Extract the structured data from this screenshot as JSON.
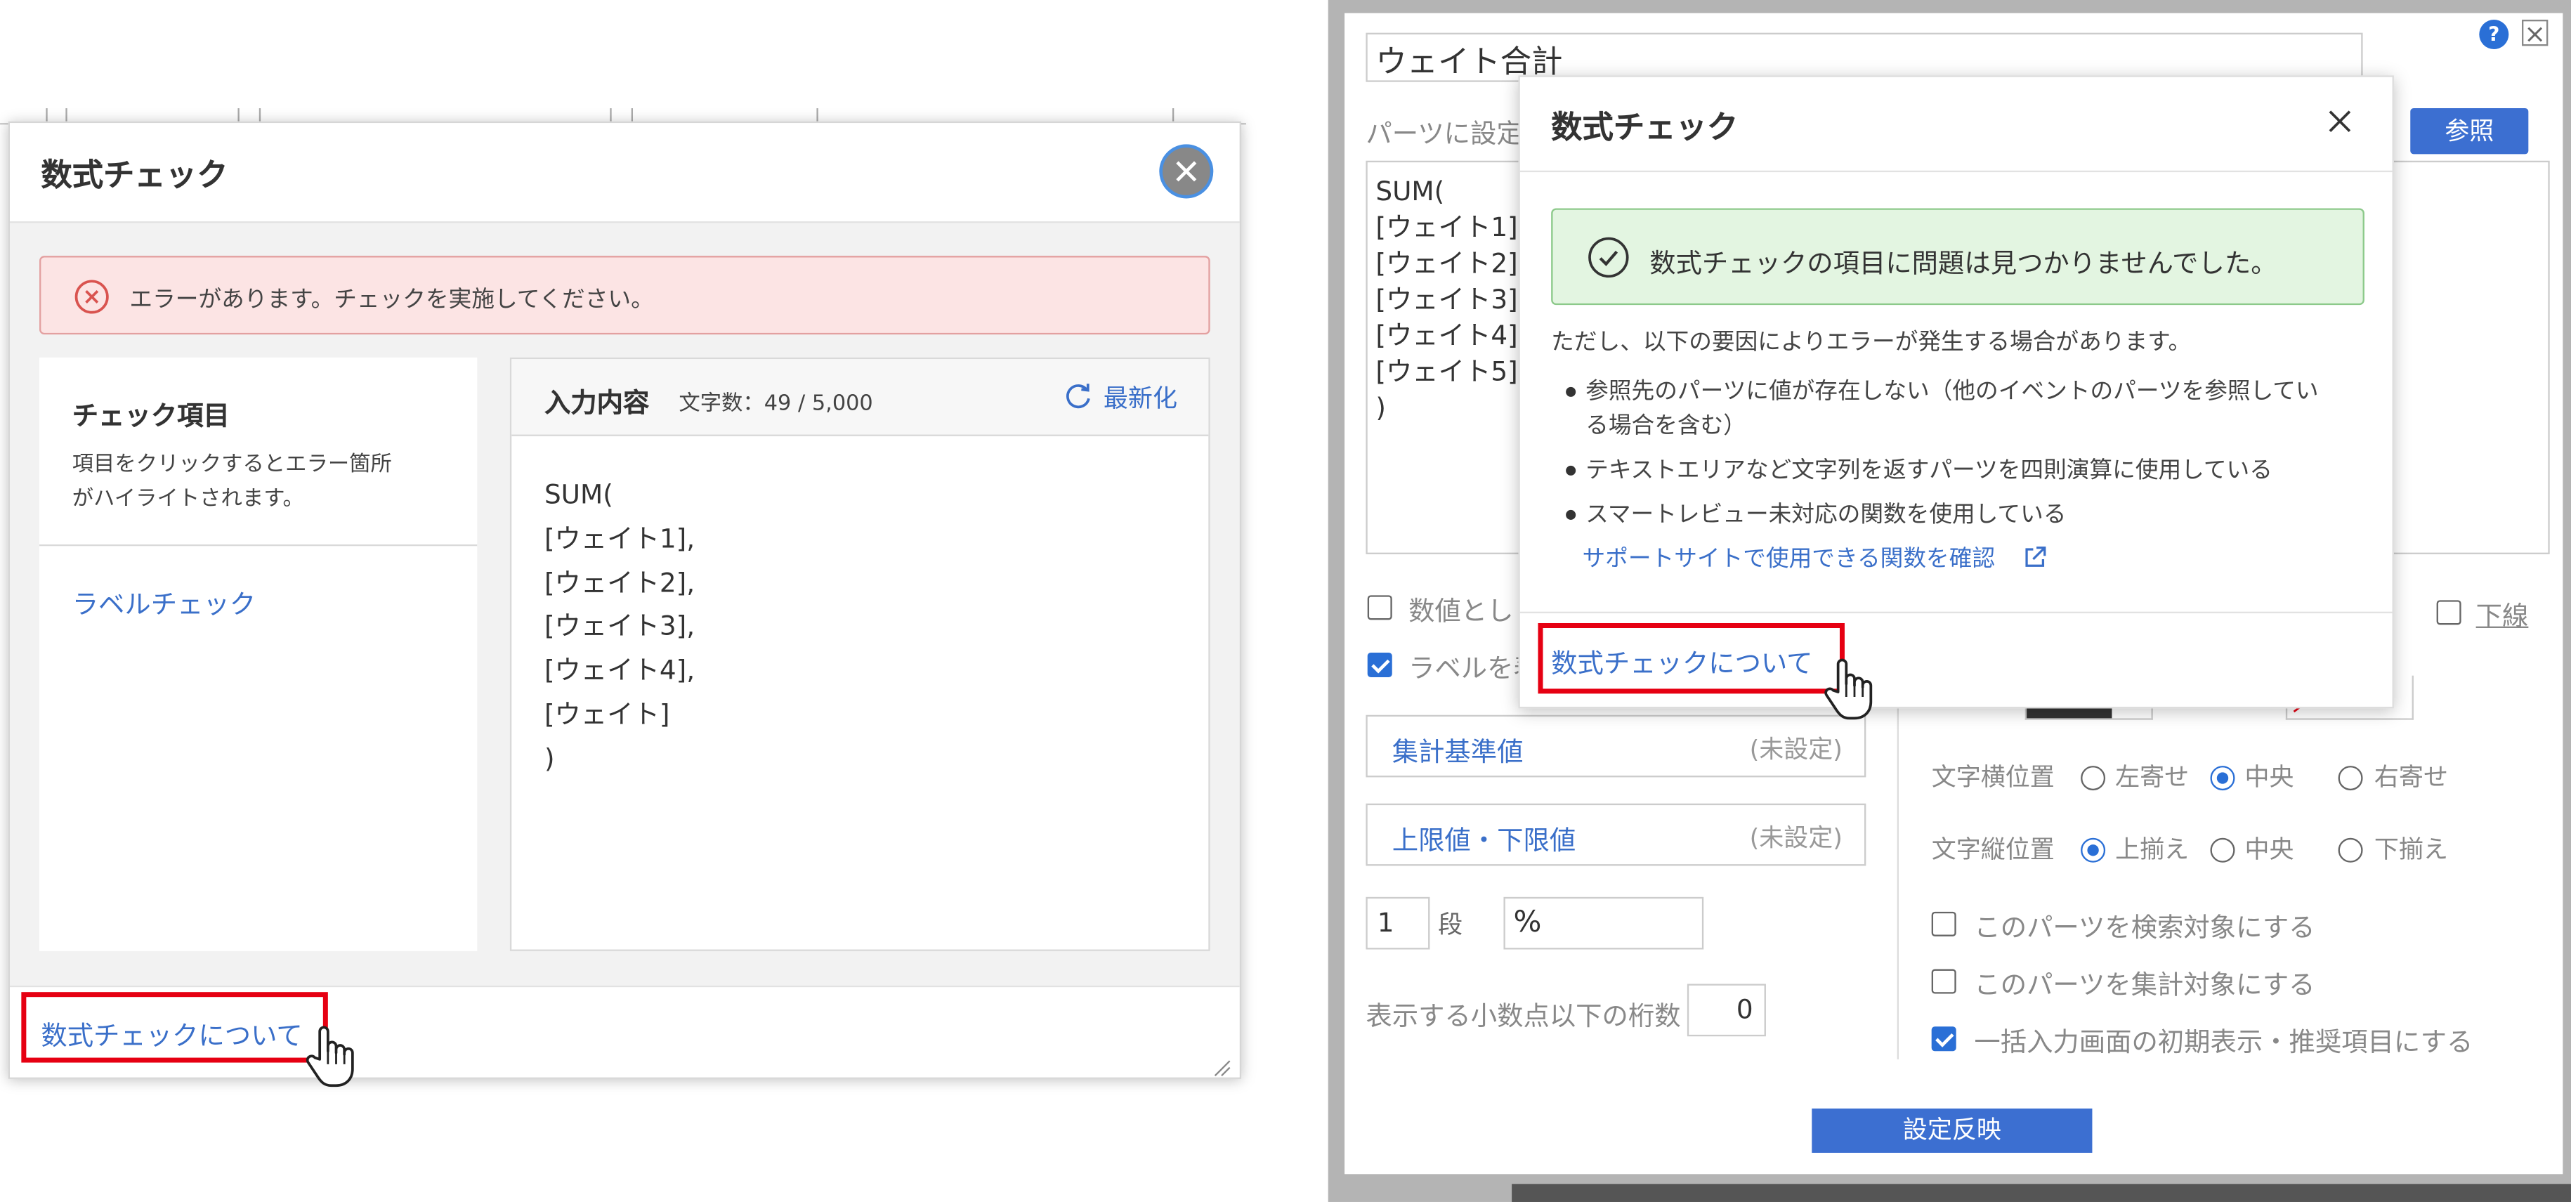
{
  "left_dialog": {
    "title": "数式チェック",
    "error_message": "エラーがあります。チェックを実施してください。",
    "check_items_title": "チェック項目",
    "check_items_desc_line1": "項目をクリックするとエラー箇所",
    "check_items_desc_line2": "がハイライトされます。",
    "label_check": "ラベルチェック",
    "input_title": "入力内容",
    "char_count": "文字数：49 / 5,000",
    "refresh": "最新化",
    "formula_lines": [
      "SUM(",
      "[ウェイト1],",
      "[ウェイト2],",
      "[ウェイト3],",
      "[ウェイト4],",
      "[ウェイト]",
      ")"
    ],
    "footer_link": "数式チェックについて"
  },
  "right_panel": {
    "name_value": "ウェイト合計",
    "parts_label": "パーツに設定",
    "browse_button": "参照",
    "formula_lines": [
      "SUM(",
      "[ウェイト1]",
      "[ウェイト2]",
      "[ウェイト3]",
      "[ウェイト4]",
      "[ウェイト5]",
      ")"
    ],
    "numeric_label": "数値とし",
    "label_toggle": "ラベルを表",
    "aggregate_base": "集計基準値",
    "aggregate_base_status": "(未設定)",
    "limits": "上限値・下限値",
    "limits_status": "(未設定)",
    "steps_value": "1",
    "steps_unit": "段",
    "unit_value": "%",
    "decimal_label": "表示する小数点以下の桁数",
    "decimal_value": "0",
    "underline": "下線",
    "h_align_label": "文字横位置",
    "h_align_options": [
      "左寄せ",
      "中央",
      "右寄せ"
    ],
    "v_align_label": "文字縦位置",
    "v_align_options": [
      "上揃え",
      "中央",
      "下揃え"
    ],
    "search_target": "このパーツを検索対象にする",
    "aggregate_target": "このパーツを集計対象にする",
    "bulk_input": "一括入力画面の初期表示・推奨項目にする",
    "apply_button": "設定反映",
    "help_icon_text": "?"
  },
  "right_dialog": {
    "title": "数式チェック",
    "success_message": "数式チェックの項目に問題は見つかりませんでした。",
    "note": "ただし、以下の要因によりエラーが発生する場合があります。",
    "bullets": [
      "参照先のパーツに値が存在しない（他のイベントのパーツを参照してい",
      "る場合を含む）",
      "テキストエリアなど文字列を返すパーツを四則演算に使用している",
      "スマートレビュー未対応の関数を使用している"
    ],
    "support_link": "サポートサイトで使用できる関数を確認",
    "footer_link": "数式チェックについて"
  },
  "colors": {
    "accent_blue": "#3a6fc9",
    "error_bg": "#fce4e4",
    "error_border": "#e3a0a0",
    "success_bg": "#e3f5e1",
    "success_border": "#8cc98a",
    "highlight_red": "#e60012",
    "button_blue": "#3c6fd1"
  }
}
